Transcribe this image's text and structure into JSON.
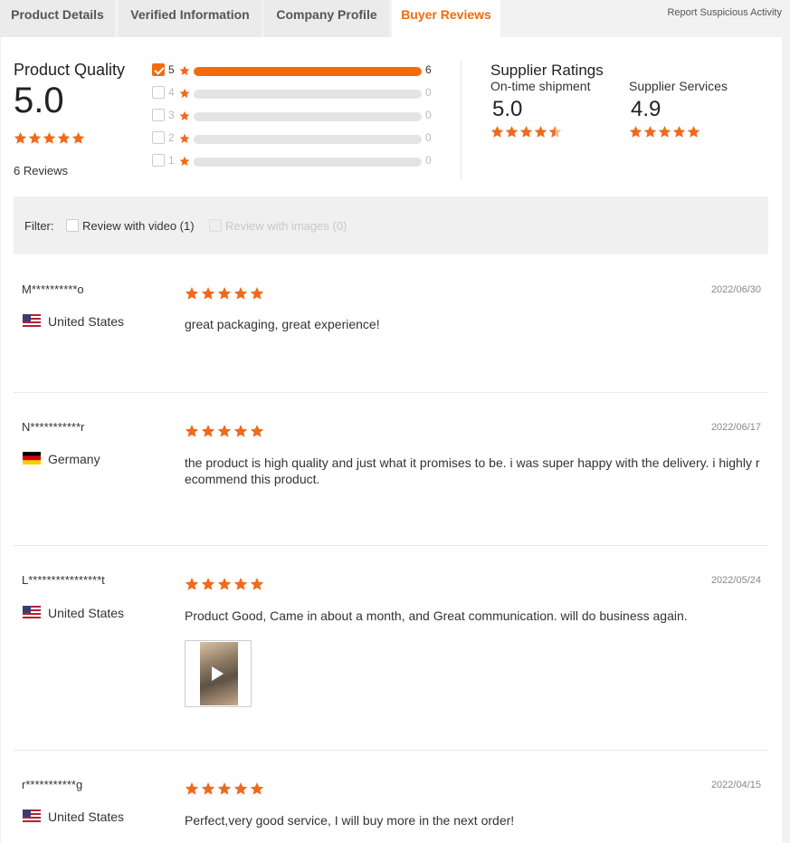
{
  "tabs": [
    {
      "label": "Product Details"
    },
    {
      "label": "Verified Information"
    },
    {
      "label": "Company Profile"
    },
    {
      "label": "Buyer Reviews",
      "active": true
    }
  ],
  "report_link": "Report Suspicious Activity",
  "product_quality": {
    "title": "Product Quality",
    "score": "5.0",
    "rating": 5,
    "reviews_count": "6 Reviews",
    "distribution": [
      {
        "stars": "5",
        "count": "6",
        "fraction": 1.0,
        "checked": true
      },
      {
        "stars": "4",
        "count": "0",
        "fraction": 0,
        "checked": false
      },
      {
        "stars": "3",
        "count": "0",
        "fraction": 0,
        "checked": false
      },
      {
        "stars": "2",
        "count": "0",
        "fraction": 0,
        "checked": false
      },
      {
        "stars": "1",
        "count": "0",
        "fraction": 0,
        "checked": false
      }
    ]
  },
  "supplier_ratings": {
    "title": "Supplier Ratings",
    "ontime": {
      "label": "On-time shipment",
      "score": "5.0"
    },
    "services": {
      "label": "Supplier Services",
      "score": "4.9"
    }
  },
  "filter": {
    "label": "Filter:",
    "video": "Review with video (1)",
    "images": "Review with images (0)"
  },
  "reviews": [
    {
      "name": "M**********o",
      "country": "United States",
      "flag": "us",
      "date": "2022/06/30",
      "rating": 5,
      "text": "great packaging, great experience!"
    },
    {
      "name": "N***********r",
      "country": "Germany",
      "flag": "de",
      "date": "2022/06/17",
      "rating": 5,
      "text": "the product is high quality and just what it promises to be. i was super happy with the delivery. i highly recommend this product."
    },
    {
      "name": "L****************t",
      "country": "United States",
      "flag": "us",
      "date": "2022/05/24",
      "rating": 5,
      "text": "Product Good, Came in about a month, and Great communication. will do business again.",
      "has_video": true
    },
    {
      "name": "r***********g",
      "country": "United States",
      "flag": "us",
      "date": "2022/04/15",
      "rating": 5,
      "text": "Perfect,very good service, I will buy more in the next order!"
    }
  ],
  "colors": {
    "accent": "#f36b0d",
    "star": "#f06a1a"
  }
}
